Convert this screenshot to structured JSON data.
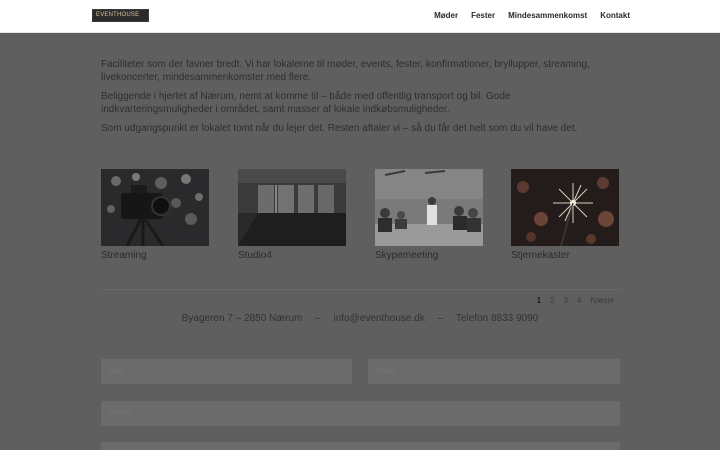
{
  "header": {
    "logo_text": "EVENTHOUSE",
    "nav": [
      "Møder",
      "Fester",
      "Mindesammenkomst",
      "Kontakt"
    ]
  },
  "intro": {
    "paragraphs": [
      "Faciliteter som der favner bredt. Vi har lokalerne til møder, events, fester, konfirmationer, bryllupper, streaming, livekoncerter, mindesammenkomster med flere.",
      "Beliggende i hjertet af Nærum, nemt at komme til – både med offentlig transport og bil. Gode indkvarteringsmuligheder i området, samt masser af lokale indkøbsmuligheder.",
      "Som udgangspunkt er lokalet tomt når du lejer det. Resten aftaler vi – så du får det helt som du vil have det."
    ]
  },
  "gallery": {
    "items": [
      {
        "caption": "Streaming",
        "icon": "camera-image"
      },
      {
        "caption": "Studio4",
        "icon": "room-image"
      },
      {
        "caption": "Skypemeeting",
        "icon": "meeting-image"
      },
      {
        "caption": "Stjernekaster",
        "icon": "sparkler-image"
      }
    ]
  },
  "pagination": {
    "pages": [
      "1",
      "2",
      "3",
      "4"
    ],
    "current": "1",
    "next_label": "Næste"
  },
  "contact": {
    "address": "Byageren 7 – 2850 Nærum",
    "separator": "–",
    "email": "info@eventhouse.dk",
    "phone": "Telefon 8833 9090"
  },
  "form": {
    "name_placeholder": "Navn",
    "email_placeholder": "Email",
    "phone_placeholder": "Telefon"
  },
  "colors": {
    "overlay": "#5f5f5f",
    "header_bg": "#ffffff",
    "field_bg": "#6b6b6b"
  }
}
